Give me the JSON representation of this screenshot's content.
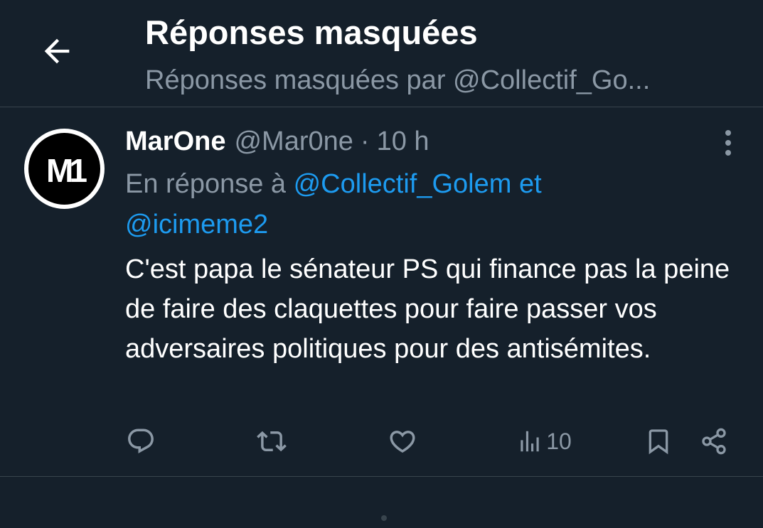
{
  "header": {
    "back_icon": "arrow-left-icon",
    "title": "Réponses masquées",
    "subtitle": "Réponses masquées par @Collectif_Go..."
  },
  "tweet": {
    "avatar_text": "M1",
    "author_name": "MarOne",
    "author_handle": "@Mar0ne",
    "separator": "·",
    "time": "10 h",
    "reply_prefix": "En réponse à ",
    "mention_1": "@Collectif_Golem",
    "reply_joiner": " et",
    "mention_2": "@icimeme2",
    "text": "C'est papa le sénateur PS qui finance pas la peine de faire des claquettes pour faire passer vos adversaires politiques pour des antisémites.",
    "views": "10"
  },
  "icons": {
    "reply": "reply-icon",
    "retweet": "retweet-icon",
    "like": "heart-icon",
    "views": "views-icon",
    "bookmark": "bookmark-icon",
    "share": "share-icon",
    "more": "more-vertical-icon"
  },
  "colors": {
    "background": "#15202b",
    "text": "#ffffff",
    "muted": "#8b98a5",
    "accent": "#1d9bf0",
    "divider": "#38444d"
  }
}
